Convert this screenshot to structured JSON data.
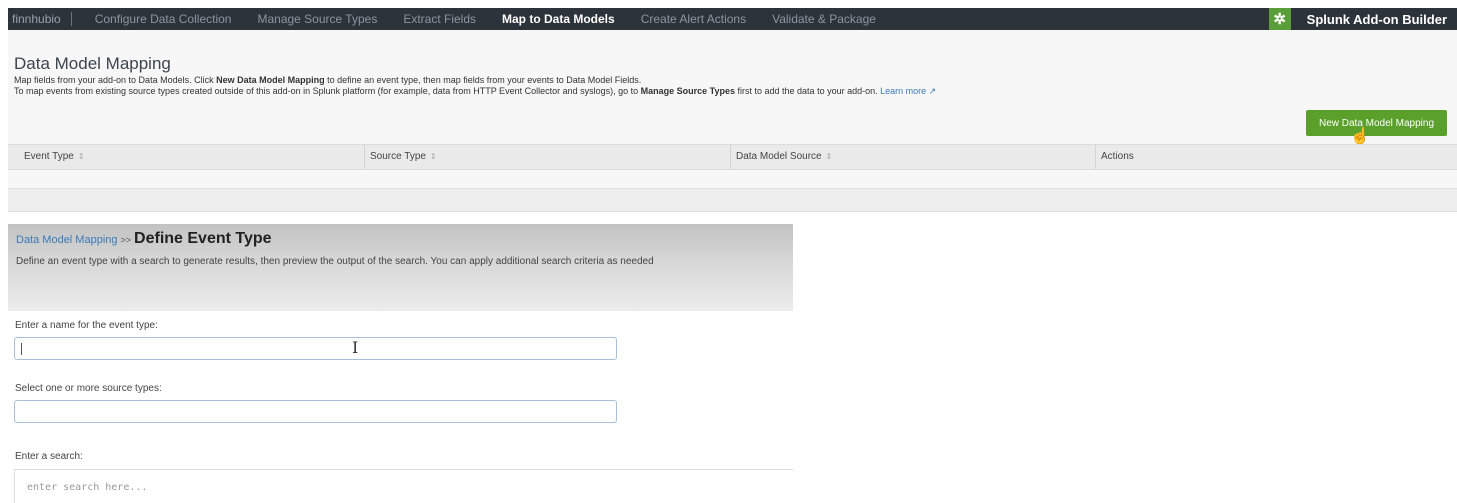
{
  "topbar": {
    "app_name": "finnhubio",
    "nav": [
      {
        "label": "Configure Data Collection",
        "active": false
      },
      {
        "label": "Manage Source Types",
        "active": false
      },
      {
        "label": "Extract Fields",
        "active": false
      },
      {
        "label": "Map to Data Models",
        "active": true
      },
      {
        "label": "Create Alert Actions",
        "active": false
      },
      {
        "label": "Validate & Package",
        "active": false
      }
    ],
    "brand": "Splunk Add-on Builder",
    "brand_icon": "gear-icon"
  },
  "mapping": {
    "title": "Data Model Mapping",
    "desc1": {
      "pre": "Map fields from your add-on to Data Models. Click ",
      "bold": "New Data Model Mapping",
      "post": " to define an event type, then map fields from your events to Data Model Fields."
    },
    "desc2": {
      "pre": "To map events from existing source types created outside of this add-on in Splunk platform (for example, data from HTTP Event Collector and syslogs), go to ",
      "bold": "Manage Source Types",
      "post": " first to add the data to your add-on. ",
      "link": "Learn more",
      "link_icon": "external-link-icon"
    },
    "new_button": "New Data Model Mapping",
    "columns": [
      "Event Type",
      "Source Type",
      "Data Model Source",
      "Actions"
    ]
  },
  "define": {
    "breadcrumb_link": "Data Model Mapping",
    "breadcrumb_sep": ">>",
    "title": "Define Event Type",
    "description": "Define an event type with a search to generate results, then preview the output of the search. You can apply additional search criteria as needed",
    "name_label": "Enter a name for the event type:",
    "name_value": "",
    "sourcetype_label": "Select one or more source types:",
    "sourcetype_value": "",
    "search_label": "Enter a search:",
    "search_placeholder": "enter search here..."
  },
  "colors": {
    "topbar_bg": "#2d333b",
    "accent_green": "#5ca02c",
    "link_blue": "#3a7ab8"
  }
}
